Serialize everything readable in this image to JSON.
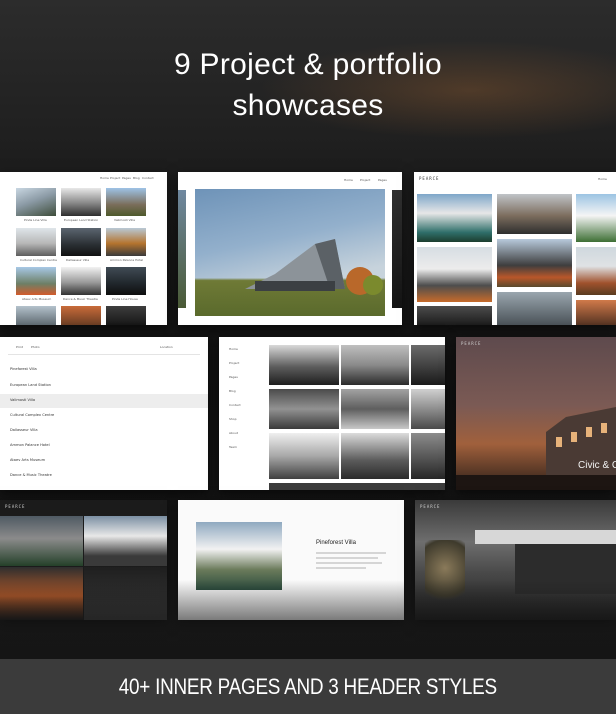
{
  "headline": {
    "line1": "9 Project & portfolio",
    "line2": "showcases"
  },
  "footer": {
    "text": "40+ INNER PAGES AND 3 HEADER STYLES"
  },
  "screens": {
    "brand": "PEARCE",
    "nav_items": [
      "Home",
      "Project",
      "Pages",
      "Blog",
      "Contact"
    ],
    "filter_tabs": [
      "Print",
      "Photo"
    ],
    "filter_right": "Location",
    "project_list": [
      "Pineforest Villa",
      "European Land Station",
      "Valimosti Villa",
      "Cultural Complex Centre",
      "Dallasseur Villa",
      "Ammon Palance Hotel",
      "Ataev Arts Museum",
      "Dance & Music Theatre"
    ],
    "grid_captions": [
      "Pinde Line Villa",
      "European Land Station",
      "Valimosti Villa",
      "Cultural Complex Centre",
      "Dallasseur Villa",
      "Ammon Palance Hotel",
      "Ataev Arts Museum",
      "Dance & Music Theatre",
      "Pinde Line House"
    ],
    "side_nav": [
      "Home",
      "Project",
      "Pages",
      "Blog",
      "Contact",
      "Shop",
      "About",
      "Team"
    ],
    "civic_caption": "Civic & C",
    "detail_title": "Pineforest Villa"
  },
  "colors": {
    "page_background": "#151515",
    "footer_background": "#3b3b3b",
    "text_light": "#ffffff"
  }
}
